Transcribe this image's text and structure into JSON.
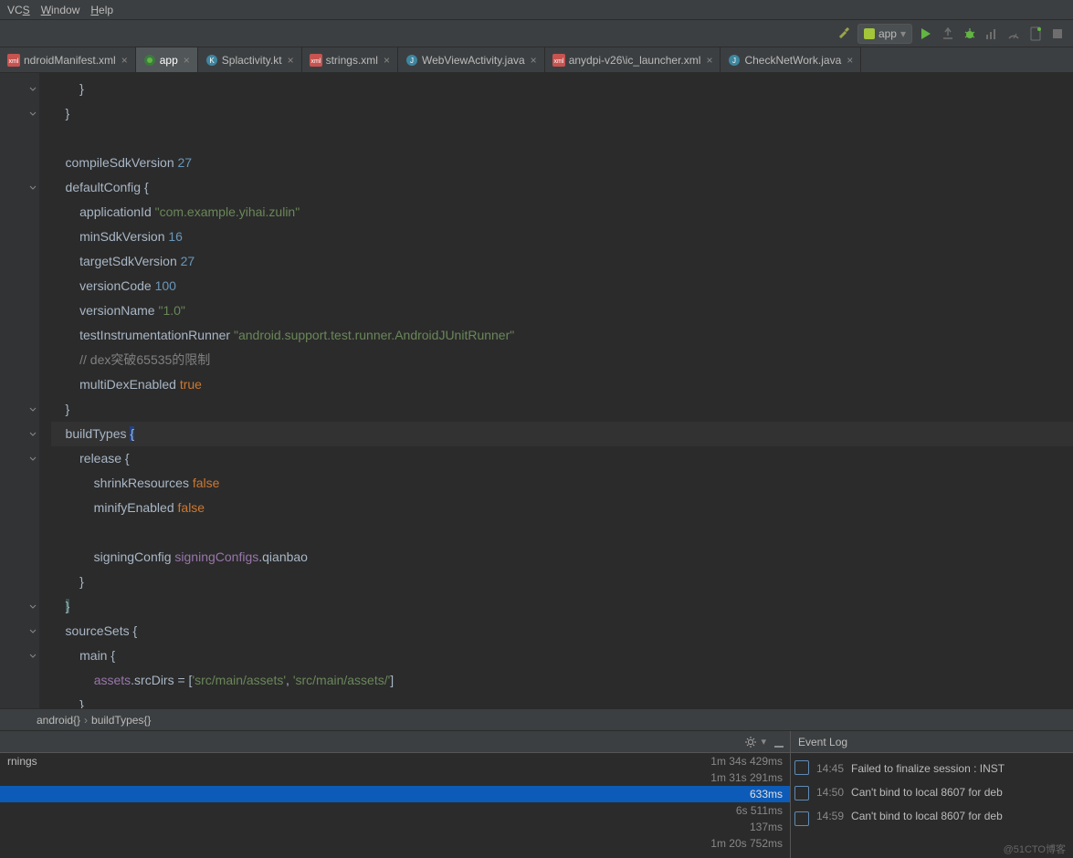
{
  "menu": {
    "vcs": "VCS",
    "window": "Window",
    "help": "Help"
  },
  "toolbar": {
    "run_config": "app",
    "run_dropdown": "▾"
  },
  "tabs": [
    {
      "name": "ndroidManifest.xml",
      "icon": "xml",
      "active": false
    },
    {
      "name": "app",
      "icon": "gradle",
      "active": true
    },
    {
      "name": "Splactivity.kt",
      "icon": "kt",
      "active": false
    },
    {
      "name": "strings.xml",
      "icon": "xml",
      "active": false
    },
    {
      "name": "WebViewActivity.java",
      "icon": "java",
      "active": false
    },
    {
      "name": "anydpi-v26\\ic_launcher.xml",
      "icon": "xml",
      "active": false
    },
    {
      "name": "CheckNetWork.java",
      "icon": "java",
      "active": false
    }
  ],
  "code": {
    "lines": [
      {
        "html": "        }"
      },
      {
        "html": "    }"
      },
      {
        "html": ""
      },
      {
        "html": "    compileSdkVersion <n>27</n>"
      },
      {
        "html": "    defaultConfig {"
      },
      {
        "html": "        applicationId <s>\"com.example.yihai.zulin\"</s>"
      },
      {
        "html": "        minSdkVersion <n>16</n>"
      },
      {
        "html": "        targetSdkVersion <n>27</n>"
      },
      {
        "html": "        versionCode <n>100</n>"
      },
      {
        "html": "        versionName <s>\"1.0\"</s>"
      },
      {
        "html": "        testInstrumentationRunner <s>\"android.support.test.runner.AndroidJUnitRunner\"</s>"
      },
      {
        "html": "        <c>// dex突破65535的限制</c>"
      },
      {
        "html": "        multiDexEnabled <k>true</k>"
      },
      {
        "html": "    }"
      },
      {
        "html": "    buildTypes <caret>{</caret>",
        "hl": true
      },
      {
        "html": "        release {"
      },
      {
        "html": "            shrinkResources <k>false</k>"
      },
      {
        "html": "            minifyEnabled <k>false</k>"
      },
      {
        "html": ""
      },
      {
        "html": "            signingConfig <p>signingConfigs</p>.qianbao"
      },
      {
        "html": "        }"
      },
      {
        "html": "    <mark>}</mark>"
      },
      {
        "html": "    sourceSets {"
      },
      {
        "html": "        main {"
      },
      {
        "html": "            <p>assets</p>.srcDirs = [<s>'src/main/assets'</s>, <s>'src/main/assets/'</s>]"
      },
      {
        "html": "        }"
      }
    ]
  },
  "breadcrumb": {
    "a": "android{}",
    "b": "buildTypes{}"
  },
  "build": {
    "rows": [
      {
        "label": "rnings",
        "time": "1m 34s 429ms"
      },
      {
        "label": "",
        "time": "1m 31s 291ms"
      },
      {
        "label": "",
        "time": "633ms",
        "selected": true
      },
      {
        "label": "",
        "time": "6s 511ms"
      },
      {
        "label": "",
        "time": "137ms"
      },
      {
        "label": "",
        "time": "1m 20s 752ms"
      }
    ]
  },
  "events": {
    "title": "Event Log",
    "items": [
      {
        "time": "14:45",
        "msg": "Failed to finalize session : INST"
      },
      {
        "time": "14:50",
        "msg": "Can't bind to local 8607 for deb"
      },
      {
        "time": "14:59",
        "msg": "Can't bind to local 8607 for deb"
      }
    ],
    "watermark": "@51CTO博客"
  }
}
